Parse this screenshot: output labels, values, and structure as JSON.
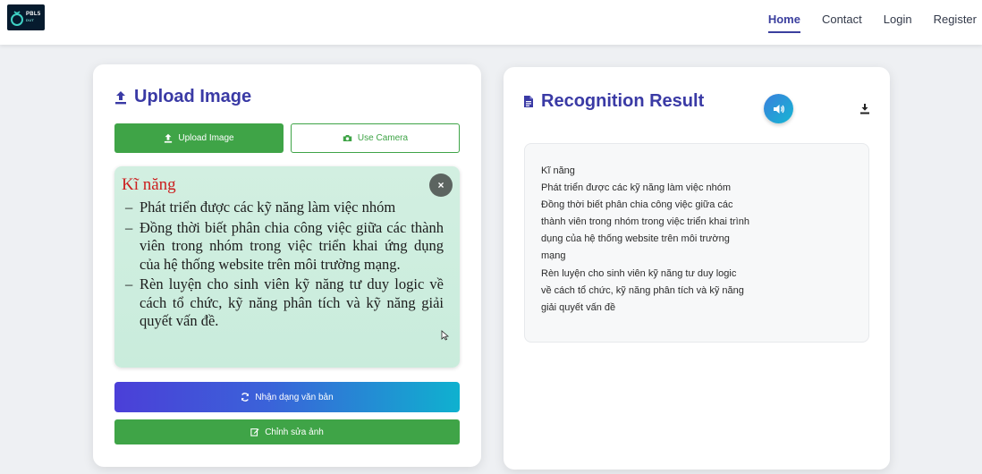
{
  "nav": {
    "logo_text": "PBL5",
    "logo_sub": "DUT",
    "links": [
      "Home",
      "Contact",
      "Login",
      "Register"
    ],
    "active": "Home"
  },
  "upload": {
    "title": "Upload Image",
    "upload_button": "Upload Image",
    "camera_button": "Use Camera",
    "preview": {
      "heading": "Kĩ năng",
      "bullets": [
        "Phát triển được các kỹ năng làm việc nhóm",
        "Đồng thời biết phân chia công việc giữa các thành viên trong nhóm trong việc triển khai ứng dụng của hệ thống website trên môi trường mạng.",
        "Rèn luyện cho sinh viên kỹ năng tư duy logic về cách tổ chức, kỹ năng phân tích và kỹ năng giải quyết vấn đề."
      ],
      "dash": "–",
      "close_symbol": "×"
    },
    "recognize_button": "Nhận dạng văn bản",
    "edit_button": "Chỉnh sửa ảnh"
  },
  "result": {
    "title": "Recognition Result",
    "lines": [
      "Kĩ năng",
      "Phát triển được các kỹ năng làm việc nhóm",
      "Đồng thời biết phân chia công việc giữa các",
      "thành viên trong nhóm trong việc triển khai trình",
      "dụng của hệ thống website trên môi trường",
      "mạng",
      "Rèn luyện cho sinh viên kỹ năng tư duy logic",
      "về cách tổ chức, kỹ năng phân tích và kỹ năng",
      "giải quyết vấn đề"
    ]
  },
  "icons": {
    "upload_title": "upload-icon",
    "result_title": "file-text-icon",
    "camera": "camera-icon",
    "recognize": "sync-icon",
    "edit": "edit-icon",
    "speak": "volume-icon",
    "download": "download-icon"
  },
  "colors": {
    "accent": "#3a3aa5",
    "green": "#3fa447",
    "gradient_start": "#4b3fd8",
    "gradient_end": "#0fb1cf",
    "preview_bg": "#d2efe1",
    "preview_heading": "#cc1f1f"
  }
}
